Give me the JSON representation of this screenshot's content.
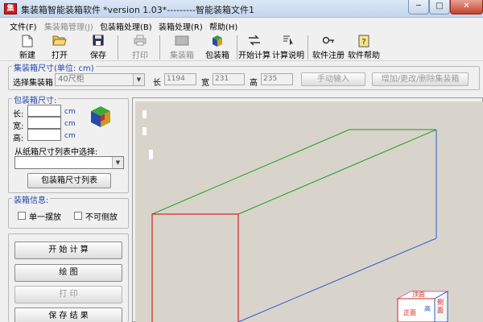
{
  "window": {
    "app_icon_text": "集",
    "app_title": "集装箱智能装箱软件",
    "file_title": "*version 1.03*---------智能装箱文件1",
    "min_glyph": "─",
    "max_glyph": "□",
    "close_glyph": "✕"
  },
  "menu": {
    "file": "文件(F)",
    "container_mgmt": "集装箱管理(J)",
    "box_process": "包装箱处理(B)",
    "packing_process": "装箱处理(R)",
    "help": "帮助(H)"
  },
  "toolbar": {
    "new": "新建",
    "open": "打开",
    "save": "保存",
    "print": "打印",
    "container": "集装箱",
    "box": "包装箱",
    "start_calc": "开始计算",
    "calc_desc": "计算说明",
    "register": "软件注册",
    "help": "软件帮助"
  },
  "container_size": {
    "title": "集装箱尺寸(单位: cm)",
    "select_label": "选择集装箱",
    "selected": "40尺柜",
    "length_label": "长",
    "length_value": "1194",
    "width_label": "宽",
    "width_value": "231",
    "height_label": "高",
    "height_value": "235",
    "manual_input": "手动输入",
    "edit_containers": "增加/更改/删除集装箱"
  },
  "box_size": {
    "title": "包装箱尺寸:",
    "length_label": "长:",
    "width_label": "宽:",
    "height_label": "高:",
    "unit": "cm",
    "list_select_label": "从纸箱尺寸列表中选择:",
    "list_selected": "",
    "list_button": "包装箱尺寸列表"
  },
  "packing_info": {
    "title": "装箱信息:",
    "single_layout": "单一摆放",
    "no_side": "不可侧放"
  },
  "actions": {
    "start": "开 始 计 算",
    "draw": "绘   图",
    "print": "打   印",
    "save_result": "保 存 结 果"
  },
  "canvas": {
    "orient_top": "顶面",
    "orient_front": "正面",
    "orient_height": "高",
    "orient_side": "侧面"
  },
  "colors": {
    "front_face": "#d42020",
    "top_edges": "#1e9e1e",
    "side_edges": "#2a5ec8"
  }
}
